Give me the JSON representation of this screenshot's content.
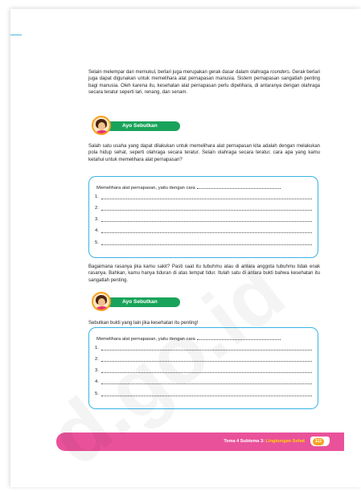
{
  "intro": {
    "text_1": "Selain melempar dan memukul, berlari juga merupakan gerak dasar dalam olahraga ",
    "text_italic": "rounders",
    "text_2": ". Gerak berlari juga dapat digunakan untuk memelihara alat pernapasan manusia. Sistem pernapasan sangatlah penting bagi manusia. Oleh karena itu, kesehatan alat pernapasan perlu dipelihara, di antaranya dengan olahraga secara teratur seperti lari, renang, dan senam."
  },
  "badge_1": {
    "label": "Ayo Sebutkan",
    "icon": "girl-avatar-icon"
  },
  "question_1": "Salah satu usaha yang dapat dilakukan untuk memelihara alat pernapasan kita adalah dengan melakukan pola hidup sehat, seperti olahraga secara teratur. Selain olahraga secara teratur, cara apa yang kamu ketahui untuk memelihara alat pernapasan?",
  "box_1": {
    "title": "Memelihara alat pernapasan, yaitu dengan cara",
    "lines": [
      "1.",
      "2.",
      "3.",
      "4.",
      "5."
    ]
  },
  "paragraph_2": "Bagaimana rasanya jika kamu sakit? Pasti saat itu tubuhmu atau di antara anggota tubuhmu tidak enak rasanya. Bahkan, kamu hanya tiduran di atas tempat tidur. Itulah satu di antara bukti bahwa kesehatan itu sangatlah penting.",
  "badge_2": {
    "label": "Ayo Sebutkan",
    "icon": "girl-avatar-icon"
  },
  "question_2": "Sebutkan bukti yang lain jika kesehatan itu penting!",
  "box_2": {
    "title": "Memelihara alat pernapasan, yaitu dengan cara",
    "lines": [
      "1.",
      "2.",
      "3.",
      "4.",
      "5."
    ]
  },
  "footer": {
    "theme": "Tema 4 Subtema 3:",
    "subtitle": "Lingkungan Sehat",
    "page_number": "111"
  },
  "watermark": "d.go.id",
  "colors": {
    "green": "#19a35a",
    "blue": "#39b4e6",
    "pink": "#e9529a",
    "orange": "#f5a21e"
  }
}
